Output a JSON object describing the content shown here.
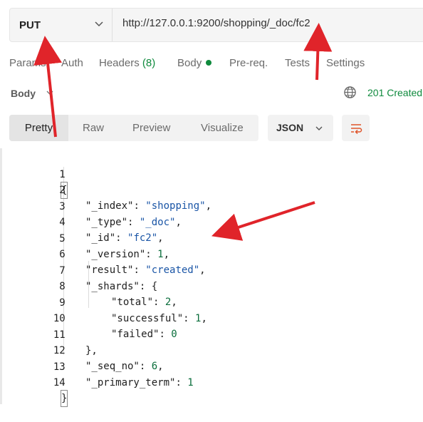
{
  "request": {
    "method": "PUT",
    "url": "http://127.0.0.1:9200/shopping/_doc/fc2"
  },
  "tabs": {
    "params": "Params",
    "auth": "Auth",
    "headers": "Headers",
    "headers_count": "(8)",
    "body": "Body",
    "prereq": "Pre-req.",
    "tests": "Tests",
    "settings": "Settings"
  },
  "response": {
    "label": "Body",
    "status": "201 Created"
  },
  "view_tabs": {
    "pretty": "Pretty",
    "raw": "Raw",
    "preview": "Preview",
    "visualize": "Visualize"
  },
  "format": "JSON",
  "code_lines": [
    {
      "n": "1",
      "text": "{"
    },
    {
      "n": "2",
      "text": "\"_index\": \"shopping\","
    },
    {
      "n": "3",
      "text": "\"_type\": \"_doc\","
    },
    {
      "n": "4",
      "text": "\"_id\": \"fc2\","
    },
    {
      "n": "5",
      "text": "\"_version\": 1,"
    },
    {
      "n": "6",
      "text": "\"result\": \"created\","
    },
    {
      "n": "7",
      "text": "\"_shards\": {"
    },
    {
      "n": "8",
      "text": "\"total\": 2,"
    },
    {
      "n": "9",
      "text": "\"successful\": 1,"
    },
    {
      "n": "10",
      "text": "\"failed\": 0"
    },
    {
      "n": "11",
      "text": "},"
    },
    {
      "n": "12",
      "text": "\"_seq_no\": 6,"
    },
    {
      "n": "13",
      "text": "\"_primary_term\": 1"
    },
    {
      "n": "14",
      "text": "}"
    }
  ],
  "colors": {
    "accent_green": "#0f8a3d",
    "annotation_red": "#e0242a",
    "string_blue": "#1a55a6"
  }
}
